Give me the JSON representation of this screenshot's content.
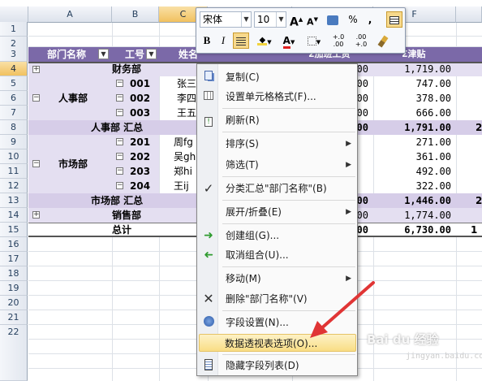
{
  "columns": [
    "A",
    "B",
    "C",
    "D",
    "E",
    "F"
  ],
  "rows": [
    "1",
    "2",
    "3",
    "4",
    "5",
    "6",
    "7",
    "8",
    "9",
    "10",
    "11",
    "12",
    "13",
    "14",
    "15",
    "16",
    "17",
    "18",
    "19",
    "20",
    "21",
    "22"
  ],
  "header_row": {
    "dept": "部门名称",
    "id": "工号",
    "name": "姓名",
    "col_e_partial": "Σ基础工资",
    "col_e2": "Σ加班工资",
    "col_f": "Σ津贴"
  },
  "row4": {
    "label": "财务部",
    "e": ".00",
    "f": "1,719.00"
  },
  "hr_group": "人事部",
  "row5": {
    "id": "001",
    "name": "张三",
    "e": ".00",
    "f": "747.00"
  },
  "row6": {
    "id": "002",
    "name": "李四",
    "e": ".00",
    "f": "378.00"
  },
  "row7": {
    "id": "003",
    "name": "王五",
    "e": ".00",
    "f": "666.00"
  },
  "row8": {
    "label": "人事部 汇总",
    "e": "00",
    "f": "1,791.00",
    "g": "2"
  },
  "mk_group": "市场部",
  "row9": {
    "id": "201",
    "name": "周fg",
    "e": ".00",
    "f": "271.00"
  },
  "row10": {
    "id": "202",
    "name": "吴gh",
    "e": ".00",
    "f": "361.00"
  },
  "row11": {
    "id": "203",
    "name": "郑hi",
    "e": ".00",
    "f": "492.00"
  },
  "row12": {
    "id": "204",
    "name": "王ij",
    "e": ".00",
    "f": "322.00"
  },
  "row13": {
    "label": "市场部 汇总",
    "e": "00",
    "f": "1,446.00",
    "g": "2"
  },
  "row14": {
    "label": "销售部",
    "e": ".00",
    "f": "1,774.00"
  },
  "row15": {
    "label": "总计",
    "e": "00",
    "f": "6,730.00",
    "g": "1"
  },
  "mini_toolbar": {
    "font": "宋体",
    "size": "10",
    "grow": "A",
    "shrink": "A",
    "percent": "%",
    "comma": ",",
    "bold": "B",
    "italic": "I",
    "fontcolor": "A",
    "dec_inc": "+.0 .00",
    "dec_dec": ".00 +.0"
  },
  "menu": [
    {
      "label": "复制(C)",
      "icon": "copy-icon"
    },
    {
      "label": "设置单元格格式(F)...",
      "icon": "format-cells-icon"
    },
    {
      "label": "刷新(R)",
      "icon": "refresh-icon"
    },
    {
      "label": "排序(S)",
      "icon": ""
    },
    {
      "label": "筛选(T)",
      "icon": ""
    },
    {
      "label": "分类汇总\"部门名称\"(B)",
      "icon": "checkmark-icon"
    },
    {
      "label": "展开/折叠(E)",
      "icon": ""
    },
    {
      "label": "创建组(G)...",
      "icon": "group-icon"
    },
    {
      "label": "取消组合(U)...",
      "icon": "ungroup-icon"
    },
    {
      "label": "移动(M)",
      "icon": ""
    },
    {
      "label": "删除\"部门名称\"(V)",
      "icon": "delete-icon"
    },
    {
      "label": "字段设置(N)...",
      "icon": "field-settings-icon"
    },
    {
      "label": "数据透视表选项(O)...",
      "icon": ""
    },
    {
      "label": "隐藏字段列表(D)",
      "icon": "field-list-icon"
    }
  ],
  "watermark": "Bai du 经验",
  "watermark_url": "jingyan.baidu.com",
  "colors": {
    "header_band": "#7b69a8",
    "lavender": "#e4dff1",
    "subtotal": "#d6cde8",
    "highlight": "#f9dd85",
    "arrow": "#e03535"
  }
}
